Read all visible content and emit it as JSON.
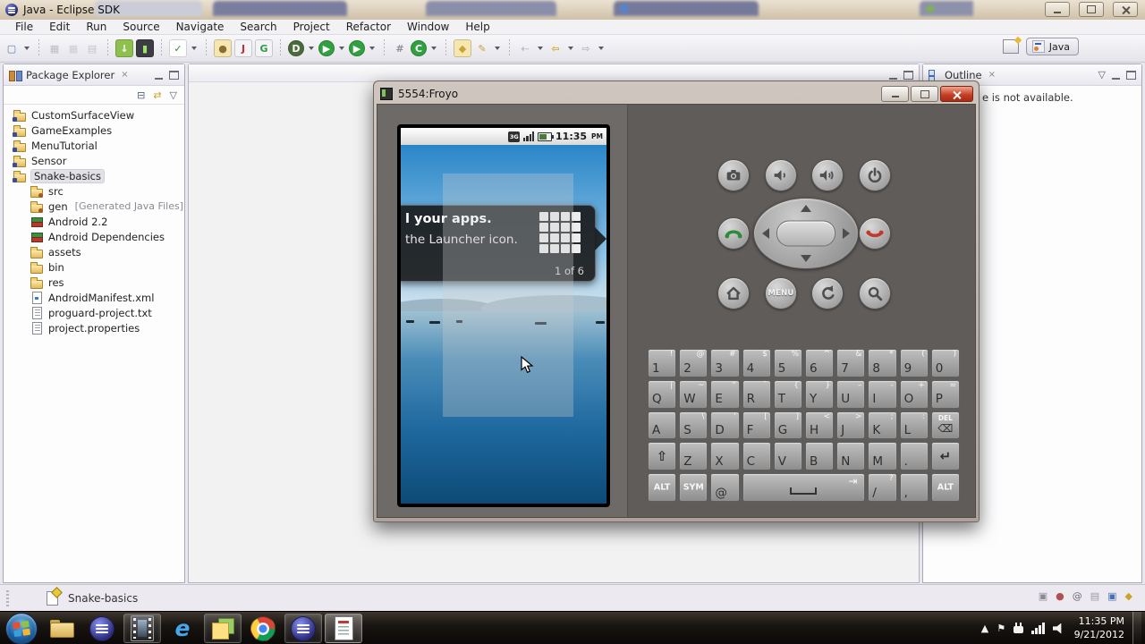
{
  "window": {
    "title": "Java - Eclipse SDK"
  },
  "menubar": {
    "items": [
      "File",
      "Edit",
      "Run",
      "Source",
      "Navigate",
      "Search",
      "Project",
      "Refactor",
      "Window",
      "Help"
    ]
  },
  "toolbar": {
    "items": [
      {
        "n": "new",
        "g": "▢",
        "c": "#5a78b5",
        "d": 1
      },
      "|",
      {
        "n": "save",
        "g": "▦",
        "c": "#bcbcc4"
      },
      {
        "n": "save-all",
        "g": "▦",
        "c": "#ccccd4"
      },
      {
        "n": "print",
        "g": "▤",
        "c": "#c4c4cc"
      },
      "|",
      {
        "n": "android-sdk-manager",
        "g": "↓",
        "c": "#ffffff",
        "bg": "#8fbf4d"
      },
      {
        "n": "avd-manager",
        "g": "▮",
        "c": "#9fe06a",
        "bg": "#3c3c44"
      },
      "|",
      {
        "n": "lint-check",
        "g": "✓",
        "c": "#2e8b2e",
        "bg": "#ffffff",
        "d": 1
      },
      "|",
      {
        "n": "new-java-package",
        "g": "●",
        "c": "#8a6d2f",
        "bg": "#f6e7b0"
      },
      {
        "n": "junit",
        "g": "J",
        "c": "#c03030",
        "bg": "#f4f4f8"
      },
      {
        "n": "new-class",
        "g": "G",
        "c": "#2f9a43",
        "bg": "#f4f4f8"
      },
      "|",
      {
        "n": "debug",
        "g": "D",
        "c": "#ffffff",
        "bg": "#4c6b3c",
        "d": 1,
        "r": 1
      },
      {
        "n": "run",
        "g": "▶",
        "c": "#ffffff",
        "bg": "#30a040",
        "d": 1,
        "r": 1
      },
      {
        "n": "external-tools",
        "g": "▶",
        "c": "#ffffff",
        "bg": "#30a040",
        "d": 1,
        "r": 1
      },
      "|",
      {
        "n": "grid",
        "g": "#",
        "c": "#90909a"
      },
      {
        "n": "coverage",
        "g": "C",
        "c": "#ffffff",
        "bg": "#30a040",
        "d": 1,
        "r": 1
      },
      "|",
      {
        "n": "open-resource",
        "g": "◆",
        "c": "#caa23a",
        "bg": "#f6e7b0"
      },
      {
        "n": "mark-occurrences",
        "g": "✎",
        "c": "#caa23a",
        "d": 1
      },
      "|",
      {
        "n": "last-edit-location",
        "g": "⇠",
        "c": "#b8b8c0",
        "d": 1
      },
      {
        "n": "back",
        "g": "⇦",
        "c": "#d2a52a",
        "d": 1
      },
      {
        "n": "forward",
        "g": "⇨",
        "c": "#b8b8c0",
        "d": 1
      }
    ]
  },
  "perspective": {
    "java": "Java"
  },
  "package_explorer": {
    "title": "Package Explorer",
    "close": "×",
    "toolbar": {
      "collapse": "⊟",
      "link": "⇄",
      "menu": "▽"
    },
    "items": [
      {
        "label": "CustomSurfaceView",
        "icon": "project",
        "level": 0
      },
      {
        "label": "GameExamples",
        "icon": "project",
        "level": 0
      },
      {
        "label": "MenuTutorial",
        "icon": "project",
        "level": 0
      },
      {
        "label": "Sensor",
        "icon": "project",
        "level": 0
      },
      {
        "label": "Snake-basics",
        "icon": "project",
        "level": 0,
        "selected": true
      },
      {
        "label": "src",
        "icon": "package",
        "level": 1
      },
      {
        "label": "gen",
        "suffix": "[Generated Java Files]",
        "icon": "package",
        "level": 1
      },
      {
        "label": "Android 2.2",
        "icon": "library",
        "level": 1
      },
      {
        "label": "Android Dependencies",
        "icon": "library",
        "level": 1
      },
      {
        "label": "assets",
        "icon": "folder",
        "level": 1
      },
      {
        "label": "bin",
        "icon": "folder",
        "level": 1
      },
      {
        "label": "res",
        "icon": "folder",
        "level": 1
      },
      {
        "label": "AndroidManifest.xml",
        "icon": "xmlfile",
        "level": 1
      },
      {
        "label": "proguard-project.txt",
        "icon": "textfile",
        "level": 1
      },
      {
        "label": "project.properties",
        "icon": "textfile",
        "level": 1
      }
    ]
  },
  "outline": {
    "title": "Outline",
    "close": "×",
    "menu": "▽",
    "message": "e is not available."
  },
  "statusbar": {
    "selection": "Snake-basics",
    "icons": [
      {
        "n": "window-stack",
        "g": "▣",
        "c": "#8a8a94"
      },
      {
        "n": "user",
        "g": "●",
        "c": "#b05050"
      },
      {
        "n": "at-sign",
        "g": "@",
        "c": "#6a6a74"
      },
      {
        "n": "file-sync",
        "g": "▤",
        "c": "#9a9aa4"
      },
      {
        "n": "display",
        "g": "▣",
        "c": "#4a6fb5"
      },
      {
        "n": "tips",
        "g": "◆",
        "c": "#c9a227"
      }
    ]
  },
  "emulator": {
    "title": "5554:Froyo",
    "menu_label": "MENU",
    "buttons": [
      "camera",
      "volume-down",
      "volume-up",
      "power",
      "call",
      "dpad",
      "end-call",
      "home",
      "menu",
      "back",
      "search"
    ],
    "phone": {
      "network": "3G",
      "clock": "11:35",
      "meridiem": "PM",
      "notification": {
        "line1": "l your apps.",
        "line2": "the Launcher icon.",
        "counter": "1 of 6"
      }
    },
    "keyboard": {
      "rows": [
        [
          {
            "m": "1",
            "a": "!"
          },
          {
            "m": "2",
            "a": "@"
          },
          {
            "m": "3",
            "a": "#"
          },
          {
            "m": "4",
            "a": "$"
          },
          {
            "m": "5",
            "a": "%"
          },
          {
            "m": "6",
            "a": "^"
          },
          {
            "m": "7",
            "a": "&"
          },
          {
            "m": "8",
            "a": "*"
          },
          {
            "m": "9",
            "a": "("
          },
          {
            "m": "0",
            "a": ")"
          }
        ],
        [
          {
            "m": "Q",
            "a": "|"
          },
          {
            "m": "W",
            "a": "~"
          },
          {
            "m": "E",
            "a": "\""
          },
          {
            "m": "R",
            "a": "`"
          },
          {
            "m": "T",
            "a": "{"
          },
          {
            "m": "Y",
            "a": "}"
          },
          {
            "m": "U",
            "a": "–"
          },
          {
            "m": "I",
            "a": "-"
          },
          {
            "m": "O",
            "a": "+"
          },
          {
            "m": "P",
            "a": "="
          }
        ],
        [
          {
            "m": "A"
          },
          {
            "m": "S",
            "a": "\\"
          },
          {
            "m": "D",
            "a": "'"
          },
          {
            "m": "F",
            "a": "["
          },
          {
            "m": "G",
            "a": "]"
          },
          {
            "m": "H",
            "a": "<"
          },
          {
            "m": "J",
            "a": ">"
          },
          {
            "m": "K",
            "a": ";"
          },
          {
            "m": "L",
            "a": ":"
          },
          {
            "m": "⌫",
            "a": "DEL",
            "k": "del"
          }
        ],
        [
          {
            "m": "⇧",
            "k": "shift"
          },
          {
            "m": "Z"
          },
          {
            "m": "X"
          },
          {
            "m": "C"
          },
          {
            "m": "V"
          },
          {
            "m": "B"
          },
          {
            "m": "N"
          },
          {
            "m": "M"
          },
          {
            "m": "."
          },
          {
            "m": "↵",
            "k": "enter"
          }
        ],
        [
          {
            "m": "ALT",
            "k": "mod"
          },
          {
            "m": "SYM",
            "k": "mod"
          },
          {
            "m": "@"
          },
          {
            "m": "",
            "a": "⇥",
            "k": "space"
          },
          {
            "m": "/",
            "a": "?"
          },
          {
            "m": ","
          },
          {
            "m": "ALT",
            "k": "mod"
          }
        ]
      ]
    }
  },
  "taskbar": {
    "items": [
      {
        "name": "start"
      },
      {
        "name": "explorer"
      },
      {
        "name": "eclipse"
      },
      {
        "name": "media",
        "active": true
      },
      {
        "name": "ie",
        "glyph": "e"
      },
      {
        "name": "notes",
        "active": true
      },
      {
        "name": "chrome"
      },
      {
        "name": "eclipse-2",
        "active": true
      },
      {
        "name": "document",
        "active": true,
        "bright": true
      }
    ],
    "tray": {
      "glyphs": {
        "expand": "▲",
        "flag": "⚑"
      },
      "time": "11:35 PM",
      "date": "9/21/2012"
    }
  }
}
